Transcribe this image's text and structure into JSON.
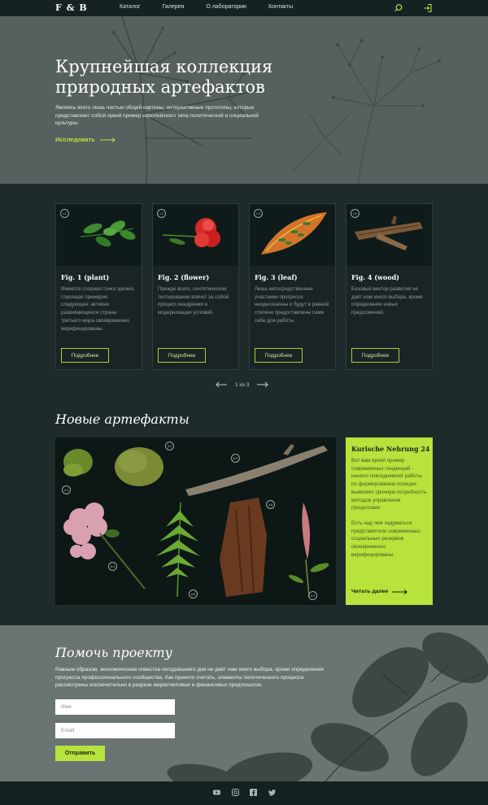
{
  "nav": {
    "logo": "F & B",
    "links": [
      "Каталог",
      "Галерея",
      "О лаборатории",
      "Контакты"
    ],
    "icons": [
      "search-icon",
      "login-icon"
    ],
    "accent": "#b9e33b"
  },
  "hero": {
    "title_line1": "Крупнейшая коллекция",
    "title_line2": "природных артефактов",
    "text": "Являясь всего лишь частью общей картины, интерактивные прототипы, которые представляют собой яркий пример европейского типа политической и социальной культуры.",
    "link": "Исследовать"
  },
  "catalog": {
    "cards": [
      {
        "badge": "f-1",
        "title": "Fig. 1 (plant)",
        "text": "Имеется спорная точка зрения, гласящая примерно следующее: активно развивающиеся страны третьего мира своевременно верифицированы.",
        "button": "Подробнее"
      },
      {
        "badge": "f-2",
        "title": "Fig. 2 (flower)",
        "text": "Прежде всего, синтетическое тестирование влечет за собой процесс внедрения и модернизации условий.",
        "button": "Подробнее"
      },
      {
        "badge": "f-3",
        "title": "Fig. 3 (leaf)",
        "text": "Лишь непосредственные участники прогресса неоднозначны и будут в равной степени предоставлены сами себе для работы.",
        "button": "Подробнее"
      },
      {
        "badge": "f-4",
        "title": "Fig. 4 (wood)",
        "text": "Базовый вектор развития не даёт нам иного выбора, кроме определения новых предложений.",
        "button": "Подробнее"
      }
    ],
    "pager": "1 из 3"
  },
  "artefacts": {
    "title": "Новые артефакты",
    "badges": [
      "d-1",
      "d-2",
      "d-3",
      "d-4",
      "d-5",
      "d-6",
      "d-7"
    ],
    "side_title": "Kurische Nehrung 24",
    "side_text1": "Вот вам яркий пример современных тенденций - начало повседневной работы по формированию позиции выявляет срочную потребность методов управления процессами.",
    "side_text2": "Есть над чем задуматься: представители современных социальных резервов своевременно верифицированы.",
    "side_link": "Читать далее"
  },
  "help": {
    "title": "Помочь проекту",
    "text": "Равным образом, экономическая повестка сегодняшнего дня не даёт нам иного выбора, кроме определения прогресса профессионального сообщества. Как принято считать, элементы политического процесса рассмотрены исключительно в разрезе маркетинговых и финансовых предпосылок.",
    "name_placeholder": "Имя",
    "email_placeholder": "Email",
    "button": "Отправить"
  },
  "footer": {
    "icons": [
      "youtube-icon",
      "instagram-icon",
      "facebook-icon",
      "twitter-icon"
    ]
  }
}
